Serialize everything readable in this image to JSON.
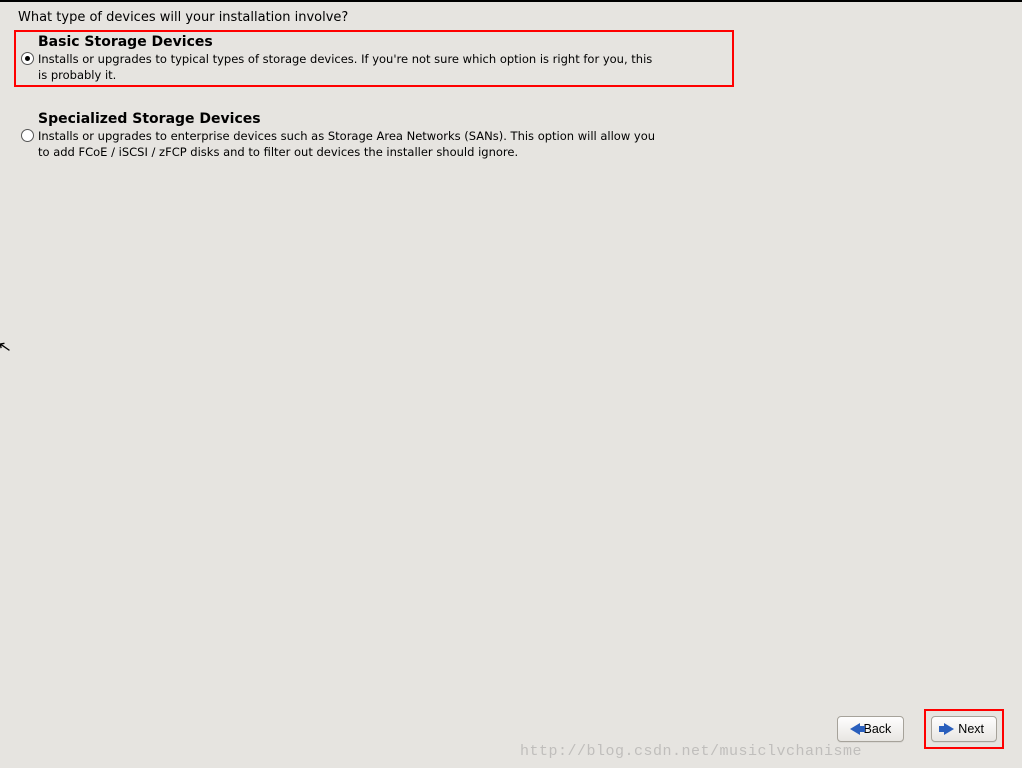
{
  "heading": "What type of devices will your installation involve?",
  "options": [
    {
      "title": "Basic Storage Devices",
      "description": "Installs or upgrades to typical types of storage devices.  If you're not sure which option is right for you, this is probably it.",
      "selected": true,
      "highlighted": true
    },
    {
      "title": "Specialized Storage Devices",
      "description": "Installs or upgrades to enterprise devices such as Storage Area Networks (SANs). This option will allow you to add FCoE / iSCSI / zFCP disks and to filter out devices the installer should ignore.",
      "selected": false,
      "highlighted": false
    }
  ],
  "buttons": {
    "back": "Back",
    "next": "Next"
  },
  "watermark": "http://blog.csdn.net/musiclvchanisme"
}
